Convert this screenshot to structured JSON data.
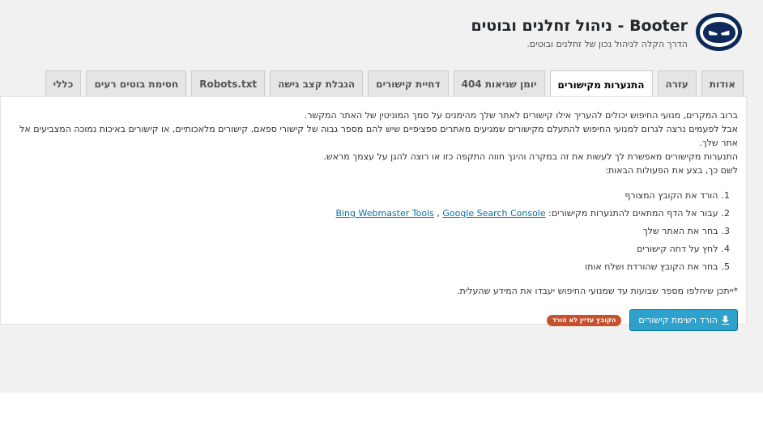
{
  "header": {
    "title": "Booter - ניהול זחלנים ובוטים",
    "subtitle": "הדרך הקלה לניהול נכון של זחלנים ובוטים."
  },
  "tabs": [
    {
      "label": "כללי",
      "active": false
    },
    {
      "label": "חסימת בוטים רעים",
      "active": false
    },
    {
      "label": "Robots.txt",
      "active": false
    },
    {
      "label": "הגבלת קצב גישה",
      "active": false
    },
    {
      "label": "דחיית קישורים",
      "active": false
    },
    {
      "label": "יומן שגיאות 404",
      "active": false
    },
    {
      "label": "התנערות מקישורים",
      "active": true
    },
    {
      "label": "עזרה",
      "active": false
    },
    {
      "label": "אודות",
      "active": false
    }
  ],
  "intro": {
    "line1": "ברוב המקרים, מנועי החיפוש יכולים להעריך אילו קישורים לאתר שלך מהימנים על סמך המוניטין של האתר המקשר.",
    "line2": "אבל לפעמים נרצה לגרום למנועי החיפוש להתעלם מקישורים שמגיעים מאתרים ספציפיים שיש להם מספר גבוה של קישורי ספאם, קישורים מלאכותיים, או קישורים באיכות נמוכה המצביעים אל אתר שלך.",
    "line3": "התנערות מקישורים מאפשרת לך לעשות את זה במקרה והינך חווה התקפה כזו או רוצה להגן על עצמך מראש.",
    "line4": "לשם כך, בצע את הפעולות הבאות:"
  },
  "steps": {
    "s1_num": "1.",
    "s1": "הורד את הקובץ המצורף",
    "s2_num": "2.",
    "s2": "עבור אל הדף המתאים להתנערות מקישורים:",
    "s2_link1": "Bing Webmaster Tools",
    "s2_sep": ",",
    "s2_link2": "Google Search Console",
    "s3_num": "3.",
    "s3": "בחר את האתר שלך",
    "s4_num": "4.",
    "s4": "לחץ על דחה קישורים",
    "s5_num": "5.",
    "s5": "בחר את הקובץ שהורדת ושלח אותו"
  },
  "note": "*ייתכן שיחלפו מספר שבועות עד שמנועי החיפוש יעבדו את המידע שהעלית.",
  "actions": {
    "download_label": "הורד רשימת קישורים",
    "download_icon": "download-icon",
    "status_badge": "הקובץ עדיין לא הורד"
  },
  "colors": {
    "accent": "#2ea2cc",
    "badge": "#c5522c",
    "logo": "#0e2a5c",
    "link": "#0073aa"
  }
}
